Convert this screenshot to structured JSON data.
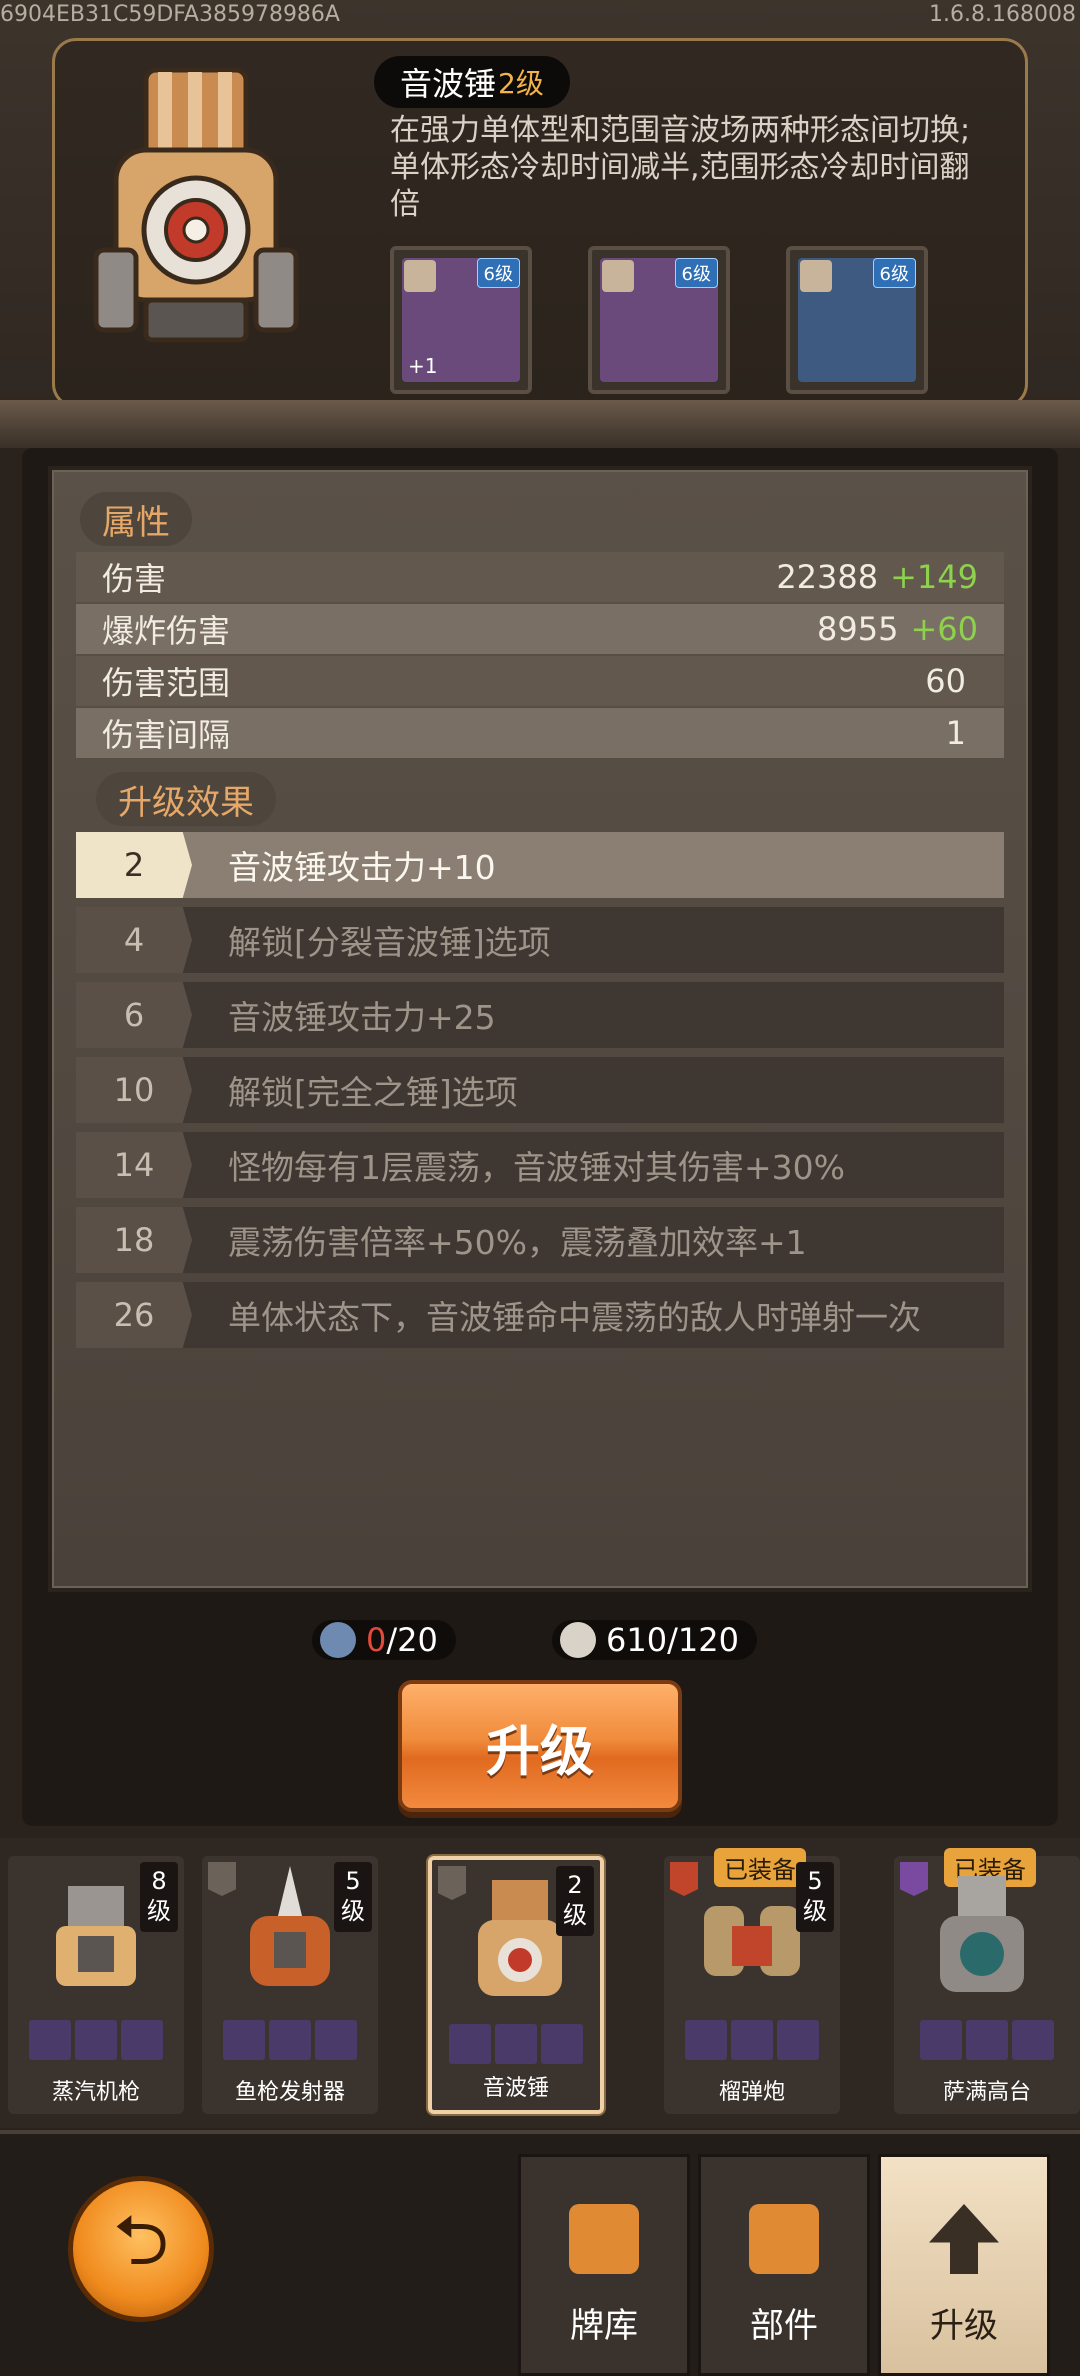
{
  "header": {
    "build_id": "6904EB31C59DFA385978986A",
    "version": "1.6.8.168008"
  },
  "weapon": {
    "name": "音波锤",
    "level": "2级",
    "description": "在强力单体型和范围音波场两种形态间切换;单体形态冷却时间减半,范围形态冷却时间翻倍",
    "parts": [
      {
        "level": "6级",
        "extra": "+1",
        "color": "#6a4a7a"
      },
      {
        "level": "6级",
        "extra": "",
        "color": "#6a4a7a"
      },
      {
        "level": "6级",
        "extra": "",
        "color": "#3e5a80"
      }
    ]
  },
  "attributes": {
    "title": "属性",
    "rows": [
      {
        "label": "伤害",
        "value": "22388",
        "bonus": "+149"
      },
      {
        "label": "爆炸伤害",
        "value": "8955",
        "bonus": "+60"
      },
      {
        "label": "伤害范围",
        "value": "60",
        "bonus": ""
      },
      {
        "label": "伤害间隔",
        "value": "1",
        "bonus": ""
      }
    ]
  },
  "upgrades": {
    "title": "升级效果",
    "rows": [
      {
        "level": "2",
        "text": "音波锤攻击力+10",
        "state": "active"
      },
      {
        "level": "4",
        "text": "解锁[分裂音波锤]选项",
        "state": "locked"
      },
      {
        "level": "6",
        "text": "音波锤攻击力+25",
        "state": "locked"
      },
      {
        "level": "10",
        "text": "解锁[完全之锤]选项",
        "state": "locked"
      },
      {
        "level": "14",
        "text": "怪物每有1层震荡，音波锤对其伤害+30%",
        "state": "locked"
      },
      {
        "level": "18",
        "text": "震荡伤害倍率+50%，震荡叠加效率+1",
        "state": "locked"
      },
      {
        "level": "26",
        "text": "单体状态下，音波锤命中震荡的敌人时弹射一次",
        "state": "locked"
      }
    ]
  },
  "currency": {
    "blueprint": {
      "have": "0",
      "need": "/20"
    },
    "gears": {
      "value": "610/120"
    }
  },
  "upgrade_button": {
    "label": "升级"
  },
  "weapons_list": [
    {
      "name": "蒸汽机枪",
      "level": "8\n级",
      "equipped": ""
    },
    {
      "name": "鱼枪发射器",
      "level": "5\n级",
      "equipped": ""
    },
    {
      "name": "音波锤",
      "level": "2\n级",
      "equipped": "",
      "selected": true
    },
    {
      "name": "榴弹炮",
      "level": "5\n级",
      "equipped": "已装备"
    },
    {
      "name": "萨满高台",
      "level": "",
      "equipped": "已装备"
    }
  ],
  "nav": {
    "tabs": [
      {
        "label": "牌库"
      },
      {
        "label": "部件"
      },
      {
        "label": "升级",
        "active": true
      }
    ],
    "back_icon": "back-arrow-icon"
  },
  "colors": {
    "bonus_green": "#8dd14c",
    "accent_orange": "#f08b3c",
    "section_tag_text": "#e6a868"
  }
}
